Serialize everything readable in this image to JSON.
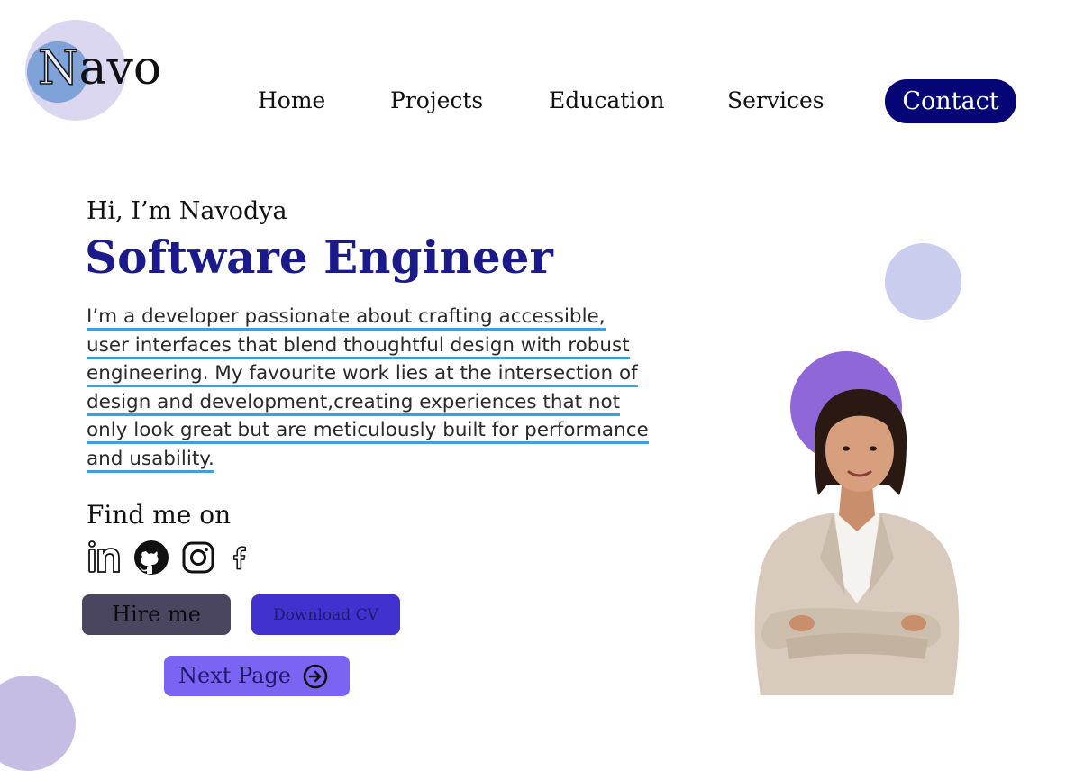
{
  "logo": {
    "first_letter": "N",
    "rest": "avo"
  },
  "nav": {
    "items": [
      {
        "label": "Home"
      },
      {
        "label": "Projects"
      },
      {
        "label": "Education"
      },
      {
        "label": "Services"
      }
    ],
    "contact_label": "Contact"
  },
  "hero": {
    "greeting": "Hi, I’m Navodya",
    "role": "Software Engineer",
    "bio_lines": [
      "I’m a developer passionate about crafting accessible,",
      "user interfaces that blend thoughtful design with robust",
      "engineering. My favourite work lies at the intersection of",
      "design and development,creating experiences that not",
      "only look  great but are meticulously built for performance",
      "and usability."
    ],
    "find_label": "Find me on"
  },
  "social": [
    {
      "icon": "linkedin-icon"
    },
    {
      "icon": "github-icon"
    },
    {
      "icon": "instagram-icon"
    },
    {
      "icon": "facebook-icon"
    }
  ],
  "buttons": {
    "hire": "Hire me",
    "cv": "Download CV",
    "next": "Next Page"
  },
  "colors": {
    "contact_bg": "#050576",
    "role_text": "#1a1a8a",
    "bio_underline": "#3aa0e0",
    "hire_bg": "#4a4660",
    "cv_bg": "#4132d0",
    "next_bg": "#7b63f4",
    "accent_circle": "#8f67d9"
  }
}
